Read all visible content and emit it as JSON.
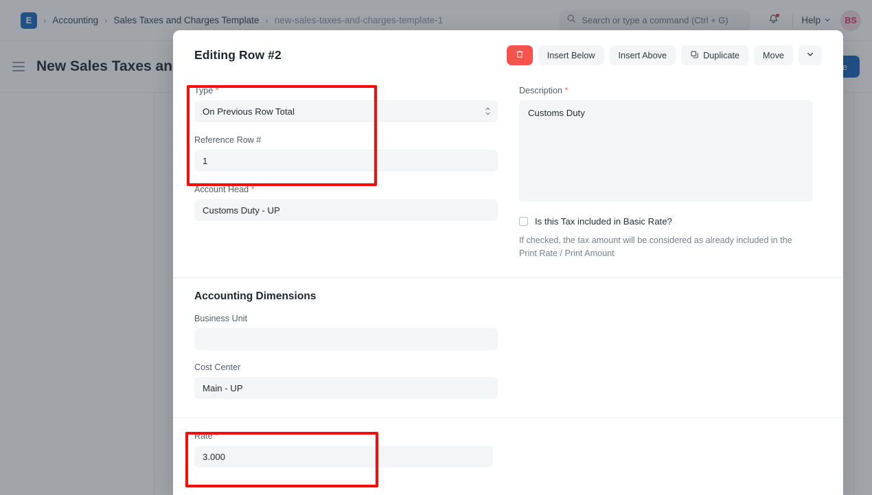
{
  "navbar": {
    "logo_text": "E",
    "breadcrumbs": [
      {
        "label": "Accounting",
        "muted": false
      },
      {
        "label": "Sales Taxes and Charges Template",
        "muted": false
      },
      {
        "label": "new-sales-taxes-and-charges-template-1",
        "muted": true
      }
    ],
    "separator": "›",
    "search": {
      "icon": "search-icon",
      "placeholder": "Search or type a command (Ctrl + G)"
    },
    "notifications": {
      "icon": "bell-icon",
      "has_unread": true
    },
    "help": {
      "label": "Help",
      "icon": "chevron-down-icon"
    },
    "avatar": {
      "initials": "BS"
    }
  },
  "page": {
    "menu_icon": "hamburger-icon",
    "title": "New Sales Taxes and",
    "primary_button": "Save"
  },
  "modal": {
    "title": "Editing Row #2",
    "actions": {
      "delete": {
        "icon": "trash-icon"
      },
      "insert_below": "Insert Below",
      "insert_above": "Insert Above",
      "duplicate": {
        "label": "Duplicate",
        "icon": "duplicate-icon"
      },
      "move": "Move",
      "more": {
        "icon": "chevron-down-icon"
      }
    },
    "fields": {
      "type": {
        "label": "Type",
        "required": true,
        "value": "On Previous Row Total",
        "icon": "select-arrows-icon"
      },
      "reference_row": {
        "label": "Reference Row #",
        "required": false,
        "value": "1"
      },
      "account_head": {
        "label": "Account Head",
        "required": true,
        "value": "Customs Duty - UP"
      },
      "description": {
        "label": "Description",
        "required": true,
        "value": "Customs Duty"
      },
      "tax_included": {
        "label": "Is this Tax included in Basic Rate?",
        "checked": false,
        "help": "If checked, the tax amount will be considered as already included in the Print Rate / Print Amount"
      },
      "business_unit": {
        "label": "Business Unit",
        "required": false,
        "value": ""
      },
      "cost_center": {
        "label": "Cost Center",
        "required": false,
        "value": "Main - UP"
      },
      "rate": {
        "label": "Rate",
        "required": true,
        "value": "3.000"
      }
    },
    "sections": {
      "accounting_dimensions": "Accounting Dimensions"
    }
  },
  "annotations": {
    "highlight_color": "#fb0b05",
    "boxes": [
      "type-and-reference-row",
      "rate"
    ]
  },
  "colors": {
    "brand_blue": "#1667c4",
    "danger_red": "#f6534c",
    "required_star": "#f56a5a",
    "field_bg": "#f4f5f6",
    "text_primary": "#1f272e",
    "text_muted": "#78818a"
  }
}
